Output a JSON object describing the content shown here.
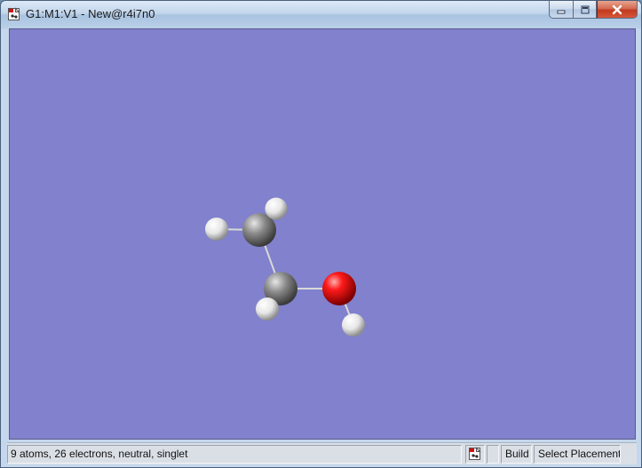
{
  "window": {
    "title": "G1:M1:V1 - New@r4i7n0",
    "icon": "gaussview-molecule-icon",
    "caption_buttons": [
      "minimize-icon",
      "maximize-icon",
      "close-icon"
    ]
  },
  "viewport": {
    "background": "#8181cd",
    "molecule": {
      "atoms": [
        {
          "element": "C",
          "color": "#7f7f7f"
        },
        {
          "element": "C",
          "color": "#7f7f7f"
        },
        {
          "element": "O",
          "color": "#e00000"
        },
        {
          "element": "H",
          "color": "#f2f2f2"
        },
        {
          "element": "H",
          "color": "#f2f2f2"
        },
        {
          "element": "H",
          "color": "#f2f2f2"
        },
        {
          "element": "H",
          "color": "#f2f2f2"
        },
        {
          "element": "H",
          "color": "#f2f2f2"
        }
      ]
    }
  },
  "statusbar": {
    "summary": "9 atoms, 26 electrons, neutral, singlet",
    "icon": "molecule-file-icon",
    "build_label": "Build",
    "mode_label": "Select Placement"
  }
}
